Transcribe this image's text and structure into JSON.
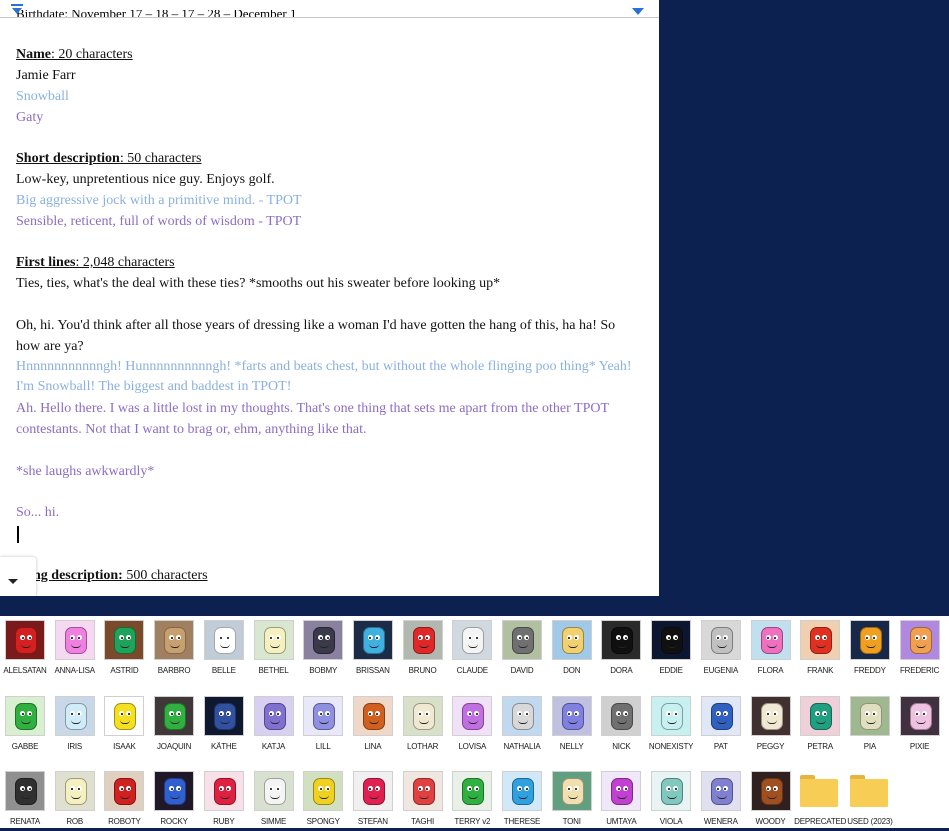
{
  "document": {
    "cut_header": "Birthdate: November 17 – 18 – 17 – 28 – December 1",
    "sections": [
      {
        "label": "Name",
        "count": ": 20 characters",
        "lines": [
          {
            "text": "Jamie Farr",
            "color": "black"
          },
          {
            "text": "Snowball",
            "color": "blue"
          },
          {
            "text": "Gaty",
            "color": "purple"
          }
        ]
      },
      {
        "label": "Short description",
        "count": ": 50 characters",
        "lines": [
          {
            "text": "Low-key, unpretentious nice guy. Enjoys golf.",
            "color": "black"
          },
          {
            "text": "Big aggressive jock with a primitive mind. - TPOT",
            "color": "blue"
          },
          {
            "text": "Sensible, reticent, full of words of wisdom - TPOT",
            "color": "purple"
          }
        ]
      },
      {
        "label": "First lines",
        "count": ": 2,048 characters",
        "lines": [
          {
            "text": "Ties, ties, what's the deal with these ties? *smooths out his sweater before looking up*",
            "color": "black"
          },
          {
            "text": "Oh, hi. You'd think after all those years of dressing like a woman I'd have gotten the hang of this, ha ha! So how are ya?",
            "color": "black"
          },
          {
            "text": "Hnnnnnnnnnnngh! Hunnnnnnnnnngh! *farts and beats chest, but without the whole flinging poo thing* Yeah! I'm Snowball! The biggest and baddest in TPOT!",
            "color": "blue"
          },
          {
            "text": "Ah. Hello there. I was a little lost in my thoughts. That's one thing that sets me apart from the other TPOT contestants. Not that I want to brag or, ehm, anything like that.",
            "color": "purple"
          },
          {
            "text": "*she laughs awkwardly*",
            "color": "purple"
          },
          {
            "text": "So... hi.",
            "color": "purple"
          }
        ]
      }
    ],
    "long_label": "Long description:",
    "long_label_visible": "ng description:",
    "long_count": " 500 characters"
  },
  "explorer": {
    "rows": [
      [
        {
          "name": "ALELSATAN",
          "color": "#d42020",
          "bg": "#7a1a1a"
        },
        {
          "name": "ANNA-LISA",
          "color": "#f080e0",
          "bg": "#f6d8f0"
        },
        {
          "name": "ASTRID",
          "color": "#1fa35a",
          "bg": "#7a4a2a"
        },
        {
          "name": "BARBRO",
          "color": "#c8a070",
          "bg": "#a08060"
        },
        {
          "name": "BELLE",
          "color": "#ffffff",
          "bg": "#c0ccd8"
        },
        {
          "name": "BETHEL",
          "color": "#f4f0c0",
          "bg": "#d8e8d0"
        },
        {
          "name": "BOBMY",
          "color": "#3a3a4a",
          "bg": "#8a80a0"
        },
        {
          "name": "BRISSAN",
          "color": "#40b0e0",
          "bg": "#1c2c48"
        },
        {
          "name": "BRUNO",
          "color": "#e02828",
          "bg": "#b0b8b0"
        },
        {
          "name": "CLAUDE",
          "color": "#f4f4f4",
          "bg": "#d0d8e0"
        },
        {
          "name": "DAVID",
          "color": "#707070",
          "bg": "#b0c0a0"
        },
        {
          "name": "DON",
          "color": "#f0d070",
          "bg": "#a0c8e8"
        },
        {
          "name": "DORA",
          "color": "#101010",
          "bg": "#2a2a2a"
        },
        {
          "name": "EDDIE",
          "color": "#101010",
          "bg": "#0c1630"
        },
        {
          "name": "EUGENIA",
          "color": "#c0c0c0",
          "bg": "#d8d8d8"
        },
        {
          "name": "FLORA",
          "color": "#f070c0",
          "bg": "#c0e0f0"
        },
        {
          "name": "FRANK",
          "color": "#e03020",
          "bg": "#f0d0b0"
        },
        {
          "name": "FREDDY",
          "color": "#f0a020",
          "bg": "#182848"
        },
        {
          "name": "FREDERIC",
          "color": "#f0a050",
          "bg": "#b088e0"
        }
      ],
      [
        {
          "name": "GABBE",
          "color": "#30b040",
          "bg": "#d8f0d0"
        },
        {
          "name": "IRIS",
          "color": "#d0ecf8",
          "bg": "#c8d8e8"
        },
        {
          "name": "ISAAK",
          "color": "#f4e020",
          "bg": "#ffffff"
        },
        {
          "name": "JOAQUIN",
          "color": "#30b040",
          "bg": "#403838"
        },
        {
          "name": "KÄTHE",
          "color": "#3050a0",
          "bg": "#101830"
        },
        {
          "name": "KATJA",
          "color": "#8070d0",
          "bg": "#d8d0f0"
        },
        {
          "name": "LILL",
          "color": "#9090e0",
          "bg": "#e8e8f8"
        },
        {
          "name": "LINA",
          "color": "#d06020",
          "bg": "#f0d8c8"
        },
        {
          "name": "LOTHAR",
          "color": "#f0e8d0",
          "bg": "#d8e0c8"
        },
        {
          "name": "LOVISA",
          "color": "#c070e0",
          "bg": "#f0e0f8"
        },
        {
          "name": "NATHALIA",
          "color": "#d8d8d8",
          "bg": "#c0d8f0"
        },
        {
          "name": "NELLY",
          "color": "#8080e0",
          "bg": "#c0c0e0"
        },
        {
          "name": "NICK",
          "color": "#707070",
          "bg": "#d0d0d0"
        },
        {
          "name": "NONEXISTY",
          "color": "#c8f0f0",
          "bg": "#c8f0f0"
        },
        {
          "name": "PAT",
          "color": "#3060c0",
          "bg": "#e0e8f8"
        },
        {
          "name": "PEGGY",
          "color": "#f0e8d0",
          "bg": "#403030"
        },
        {
          "name": "PETRA",
          "color": "#20a080",
          "bg": "#f0d0d8"
        },
        {
          "name": "PIA",
          "color": "#e0e0c0",
          "bg": "#a0b890"
        },
        {
          "name": "PIXIE",
          "color": "#f0c0e0",
          "bg": "#403040"
        }
      ],
      [
        {
          "name": "RENATA",
          "color": "#303030",
          "bg": "#909090"
        },
        {
          "name": "ROB",
          "color": "#f4f0c0",
          "bg": "#e0e0d0"
        },
        {
          "name": "ROBOTY",
          "color": "#d02020",
          "bg": "#e0d0c0"
        },
        {
          "name": "ROCKY",
          "color": "#3060d0",
          "bg": "#201828"
        },
        {
          "name": "RUBY",
          "color": "#e02040",
          "bg": "#f8e0e8"
        },
        {
          "name": "SIMME",
          "color": "#f4f4f4",
          "bg": "#d8e0d0"
        },
        {
          "name": "SPONGY",
          "color": "#f0d020",
          "bg": "#d0e0c0"
        },
        {
          "name": "STEFAN",
          "color": "#e02050",
          "bg": "#f0f0f0"
        },
        {
          "name": "TAGHI",
          "color": "#e04040",
          "bg": "#f0e8e0"
        },
        {
          "name": "TERRY v2",
          "color": "#30b040",
          "bg": "#e8f0e8"
        },
        {
          "name": "THERESE",
          "color": "#30a0e0",
          "bg": "#d0e8f8"
        },
        {
          "name": "TONI",
          "color": "#f0e0b0",
          "bg": "#60a080"
        },
        {
          "name": "UMTAYA",
          "color": "#c040d0",
          "bg": "#f0e8f8"
        },
        {
          "name": "VIOLA",
          "color": "#80c8c0",
          "bg": "#e8f4f4"
        },
        {
          "name": "WENERA",
          "color": "#8080d0",
          "bg": "#e0e0f0"
        },
        {
          "name": "WOODY",
          "color": "#a05020",
          "bg": "#302020"
        },
        {
          "name": "DEPRECATED",
          "folder": true
        },
        {
          "name": "USED (2023)",
          "folder": true
        }
      ]
    ]
  }
}
